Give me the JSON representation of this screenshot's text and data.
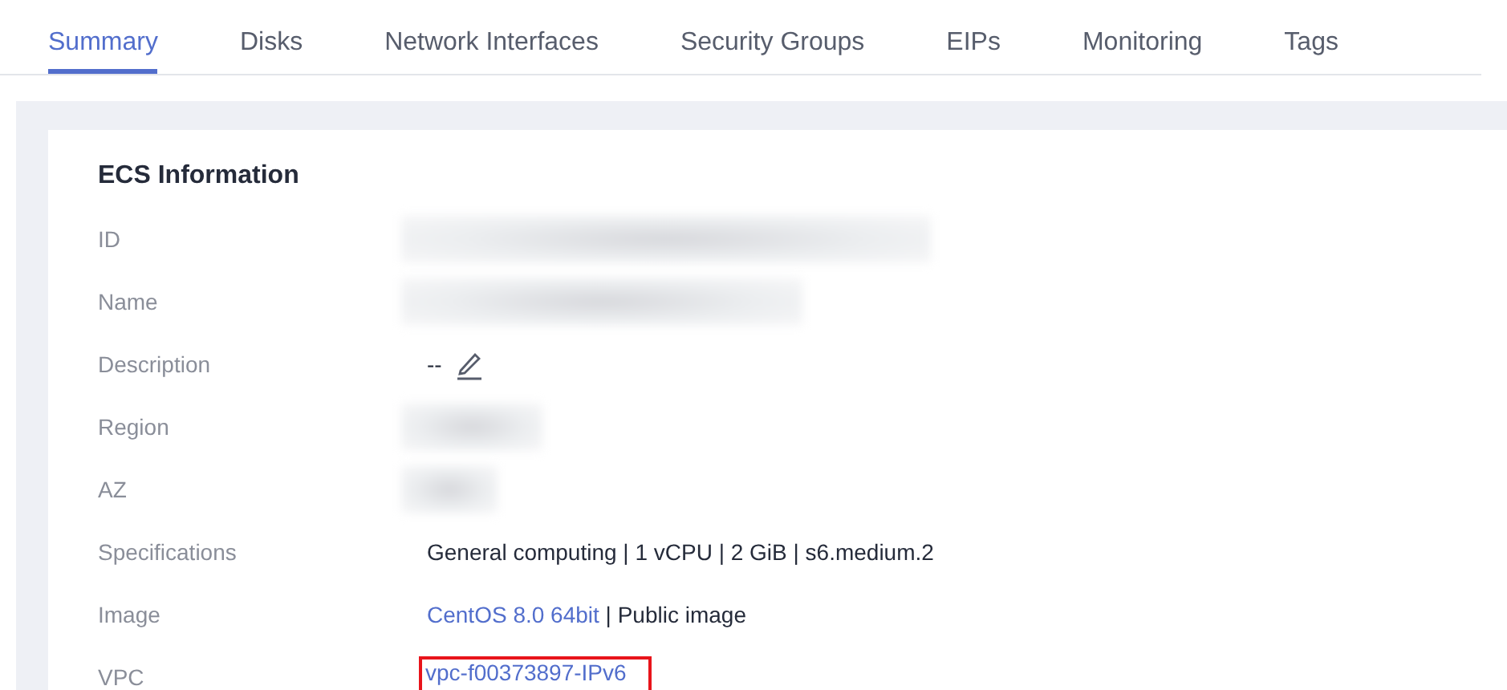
{
  "tabs": [
    {
      "label": "Summary",
      "selected": true
    },
    {
      "label": "Disks",
      "selected": false
    },
    {
      "label": "Network Interfaces",
      "selected": false
    },
    {
      "label": "Security Groups",
      "selected": false
    },
    {
      "label": "EIPs",
      "selected": false
    },
    {
      "label": "Monitoring",
      "selected": false
    },
    {
      "label": "Tags",
      "selected": false
    }
  ],
  "ecs_information": {
    "title": "ECS Information",
    "rows": [
      {
        "label": "ID",
        "kind": "redacted"
      },
      {
        "label": "Name",
        "kind": "redacted"
      },
      {
        "label": "Description",
        "kind": "editable",
        "value": "--"
      },
      {
        "label": "Region",
        "kind": "redacted"
      },
      {
        "label": "AZ",
        "kind": "redacted"
      },
      {
        "label": "Specifications",
        "kind": "text",
        "value": "General computing | 1 vCPU | 2 GiB | s6.medium.2"
      },
      {
        "label": "Image",
        "kind": "link_text",
        "link": "CentOS 8.0 64bit",
        "value": " | Public image"
      },
      {
        "label": "VPC",
        "kind": "link",
        "link": "vpc-f00373897-IPv6",
        "highlighted": true
      }
    ]
  }
}
